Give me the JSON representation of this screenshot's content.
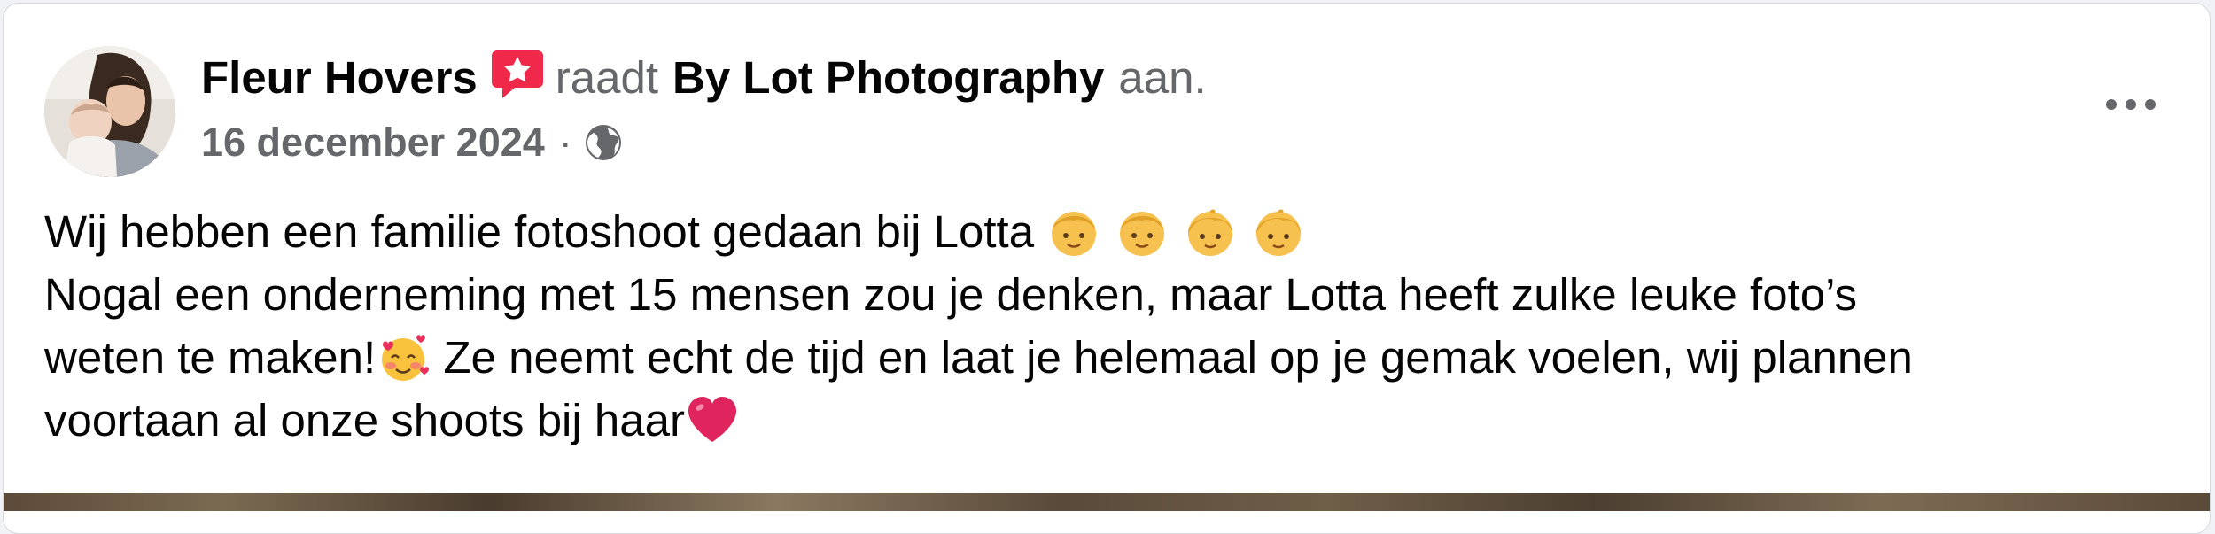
{
  "post": {
    "author": {
      "name": "Fleur Hovers",
      "avatar_icon": "avatar-photo",
      "badge_icon": "recommendation-star-icon"
    },
    "header": {
      "verb": "raadt",
      "page_name": "By Lot Photography",
      "suffix": "aan."
    },
    "meta": {
      "date": "16 december 2024",
      "separator": "·",
      "audience_icon": "globe-icon"
    },
    "more_icon": "more-options-icon",
    "body": {
      "line1": "Wij hebben een familie fotoshoot gedaan bij Lotta",
      "line1_emojis": [
        "boy-emoji",
        "boy-emoji",
        "child-emoji",
        "child-emoji"
      ],
      "line2": "Nogal een onderneming met 15 mensen zou je denken, maar Lotta heeft zulke leuke foto’s",
      "line3_start": "weten te maken!",
      "line3_emoji": "smiling-face-with-hearts-emoji",
      "line3_end": " Ze neemt echt de tijd en laat je helemaal op je gemak voelen, wij plannen",
      "line4": "voortaan al onze shoots bij haar",
      "line4_emoji": "red-heart-emoji"
    },
    "colors": {
      "text_primary": "#050505",
      "text_secondary": "#65676b",
      "badge": "#f02849",
      "heart": "#e0245e"
    }
  }
}
